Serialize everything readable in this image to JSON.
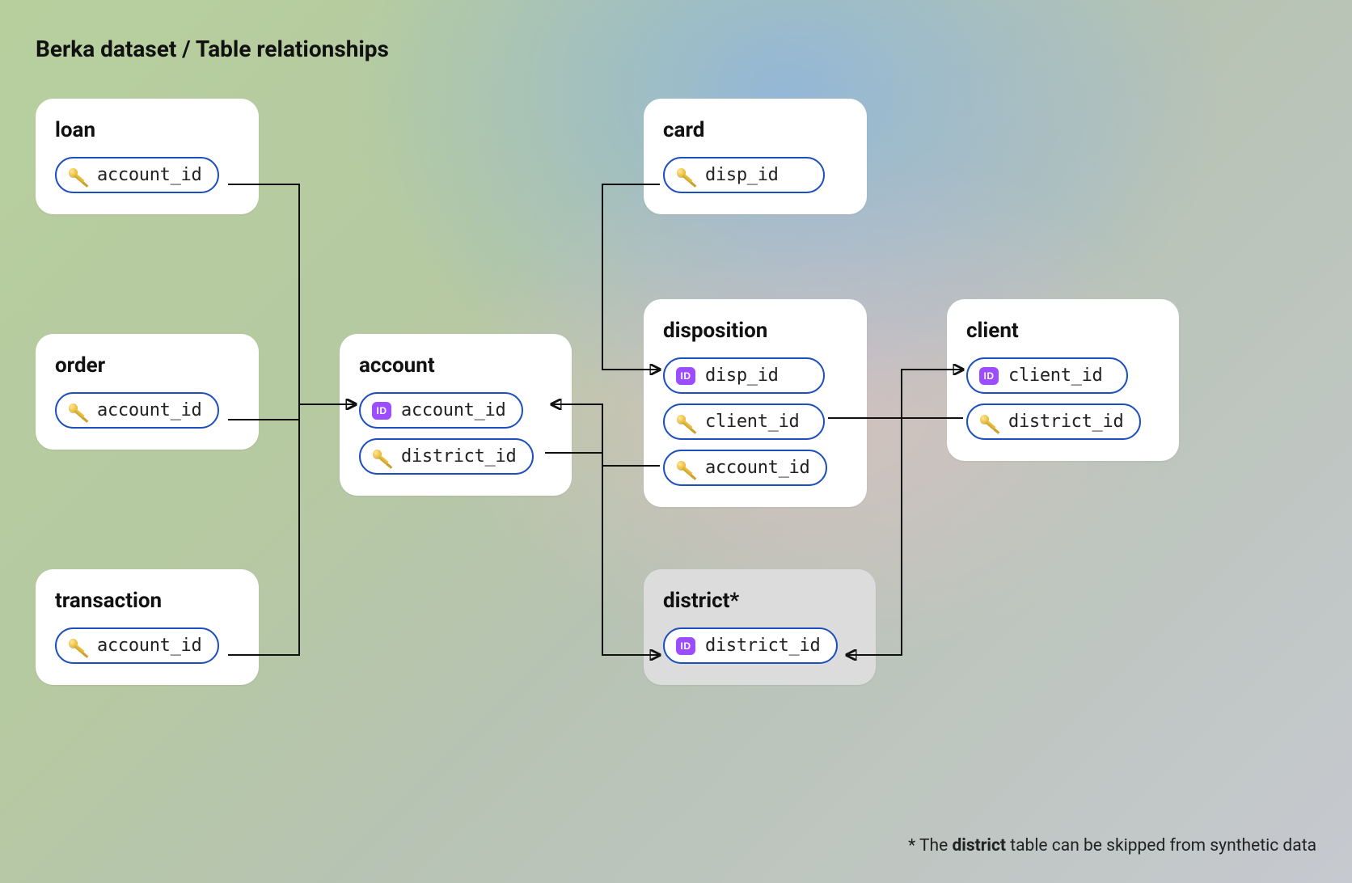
{
  "title": "Berka dataset / Table relationships",
  "tables": {
    "loan": {
      "name": "loan",
      "fields": [
        {
          "kind": "fk",
          "label": "account_id"
        }
      ]
    },
    "order": {
      "name": "order",
      "fields": [
        {
          "kind": "fk",
          "label": "account_id"
        }
      ]
    },
    "transaction": {
      "name": "transaction",
      "fields": [
        {
          "kind": "fk",
          "label": "account_id"
        }
      ]
    },
    "account": {
      "name": "account",
      "fields": [
        {
          "kind": "pk",
          "label": "account_id"
        },
        {
          "kind": "fk",
          "label": "district_id"
        }
      ]
    },
    "card": {
      "name": "card",
      "fields": [
        {
          "kind": "fk",
          "label": "disp_id"
        }
      ]
    },
    "disposition": {
      "name": "disposition",
      "fields": [
        {
          "kind": "pk",
          "label": "disp_id"
        },
        {
          "kind": "fk",
          "label": "client_id"
        },
        {
          "kind": "fk",
          "label": "account_id"
        }
      ]
    },
    "client": {
      "name": "client",
      "fields": [
        {
          "kind": "pk",
          "label": "client_id"
        },
        {
          "kind": "fk",
          "label": "district_id"
        }
      ]
    },
    "district": {
      "name": "district*",
      "fields": [
        {
          "kind": "pk",
          "label": "district_id"
        }
      ]
    }
  },
  "footnote_prefix": "* The ",
  "footnote_bold": "district",
  "footnote_suffix": " table can be skipped from synthetic data",
  "id_icon_text": "ID",
  "relationships": [
    {
      "from": "loan.account_id",
      "to": "account.account_id"
    },
    {
      "from": "order.account_id",
      "to": "account.account_id"
    },
    {
      "from": "transaction.account_id",
      "to": "account.account_id"
    },
    {
      "from": "account.district_id",
      "to": "district.district_id"
    },
    {
      "from": "card.disp_id",
      "to": "disposition.disp_id"
    },
    {
      "from": "disposition.client_id",
      "to": "client.client_id"
    },
    {
      "from": "disposition.account_id",
      "to": "account.account_id"
    },
    {
      "from": "client.district_id",
      "to": "district.district_id"
    }
  ]
}
